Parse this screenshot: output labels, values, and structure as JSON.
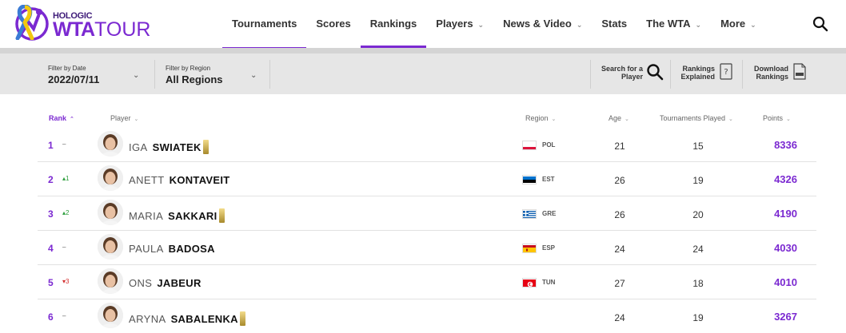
{
  "logo": {
    "hologic": "HOLOGIC",
    "wta": "WTA",
    "tour": "TOUR"
  },
  "nav": [
    {
      "label": "Tournaments",
      "caret": false,
      "state": "underline"
    },
    {
      "label": "Scores",
      "caret": false,
      "state": ""
    },
    {
      "label": "Rankings",
      "caret": false,
      "state": "active"
    },
    {
      "label": "Players",
      "caret": true,
      "state": ""
    },
    {
      "label": "News & Video",
      "caret": true,
      "state": ""
    },
    {
      "label": "Stats",
      "caret": false,
      "state": ""
    },
    {
      "label": "The WTA",
      "caret": true,
      "state": ""
    },
    {
      "label": "More",
      "caret": true,
      "state": ""
    }
  ],
  "filters": {
    "date_label": "Filter by Date",
    "date_value": "2022/07/11",
    "region_label": "Filter by Region",
    "region_value": "All Regions",
    "search_line1": "Search for a",
    "search_line2": "Player",
    "explained_line1": "Rankings",
    "explained_line2": "Explained",
    "download_line1": "Download",
    "download_line2": "Rankings"
  },
  "columns": {
    "rank": "Rank",
    "player": "Player",
    "region": "Region",
    "age": "Age",
    "tournaments": "Tournaments Played",
    "points": "Points"
  },
  "rows": [
    {
      "rank": "1",
      "move": "–",
      "dir": "none",
      "first": "IGA",
      "last": "SWIATEK",
      "badge": true,
      "flag": "POL",
      "region": "POL",
      "age": "21",
      "tournaments": "15",
      "points": "8336"
    },
    {
      "rank": "2",
      "move": "▴1",
      "dir": "up",
      "first": "ANETT",
      "last": "KONTAVEIT",
      "badge": false,
      "flag": "EST",
      "region": "EST",
      "age": "26",
      "tournaments": "19",
      "points": "4326"
    },
    {
      "rank": "3",
      "move": "▴2",
      "dir": "up",
      "first": "MARIA",
      "last": "SAKKARI",
      "badge": true,
      "flag": "GRE",
      "region": "GRE",
      "age": "26",
      "tournaments": "20",
      "points": "4190"
    },
    {
      "rank": "4",
      "move": "–",
      "dir": "none",
      "first": "PAULA",
      "last": "BADOSA",
      "badge": false,
      "flag": "ESP",
      "region": "ESP",
      "age": "24",
      "tournaments": "24",
      "points": "4030"
    },
    {
      "rank": "5",
      "move": "▾3",
      "dir": "down",
      "first": "ONS",
      "last": "JABEUR",
      "badge": false,
      "flag": "TUN",
      "region": "TUN",
      "age": "27",
      "tournaments": "18",
      "points": "4010"
    },
    {
      "rank": "6",
      "move": "–",
      "dir": "none",
      "first": "ARYNA",
      "last": "SABALENKA",
      "badge": true,
      "flag": "",
      "region": "",
      "age": "24",
      "tournaments": "19",
      "points": "3267"
    }
  ],
  "colors": {
    "brand": "#7b29d1",
    "up": "#2a9d3a",
    "down": "#d32f2f"
  }
}
